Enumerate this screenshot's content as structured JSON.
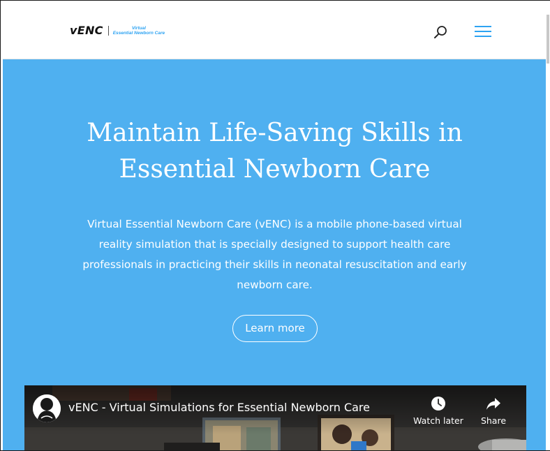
{
  "header": {
    "logo_mark": "vENC",
    "logo_sub_line1": "Virtual",
    "logo_sub_line2": "Essential Newborn Care",
    "search_icon": "search-icon",
    "menu_icon": "hamburger-menu-icon"
  },
  "hero": {
    "title": "Maintain Life-Saving Skills in Essential Newborn Care",
    "description": "Virtual Essential Newborn Care (vENC) is a mobile phone-based virtual reality simulation that is specially designed to support health care professionals in practicing their skills in neonatal resuscitation and early newborn care.",
    "cta_label": "Learn more"
  },
  "video": {
    "title": "vENC - Virtual Simulations for Essential Newborn Care",
    "watch_later_label": "Watch later",
    "share_label": "Share",
    "watch_later_icon": "clock-icon",
    "share_icon": "share-arrow-icon"
  },
  "colors": {
    "hero_bg": "#4fb0f0",
    "accent": "#2ea3f2",
    "text_on_hero": "#ffffff"
  }
}
